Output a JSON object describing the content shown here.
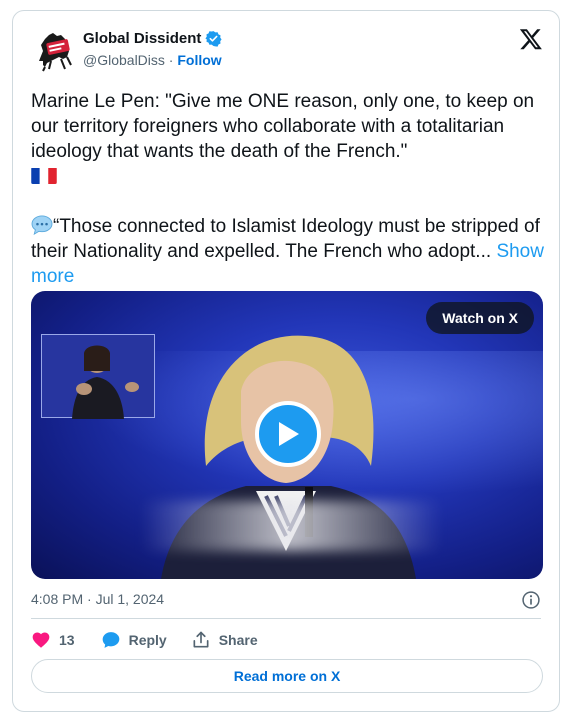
{
  "author": {
    "name": "Global Dissident",
    "handle": "@GlobalDiss",
    "separator": "·",
    "follow_label": "Follow",
    "avatar_icon": "horse-logo-avatar",
    "verified_icon": "verified-badge-icon"
  },
  "tweet": {
    "paragraph1": "Marine Le Pen: \"Give me ONE reason, only one, to keep on our territory foreigners who collaborate with a totalitarian ideology that wants the death of the French.\"",
    "flag_icon": "french-flag-icon",
    "paragraph2": "“Those connected to Islamist Ideology must be stripped of their Nationality and expelled. The French who adopt...",
    "speech_icon": "speech-bubble-icon",
    "show_more_label": "Show more"
  },
  "media": {
    "watch_label": "Watch on X",
    "play_icon": "play-icon"
  },
  "meta": {
    "timestamp": "4:08 PM · Jul 1, 2024",
    "info_icon": "info-icon"
  },
  "actions": {
    "like_count": "13",
    "reply_label": "Reply",
    "share_label": "Share"
  },
  "footer": {
    "read_more_label": "Read more on X"
  },
  "colors": {
    "accent": "#1d9bf0",
    "link": "#006fd6",
    "like": "#f91880",
    "muted": "#536471"
  }
}
